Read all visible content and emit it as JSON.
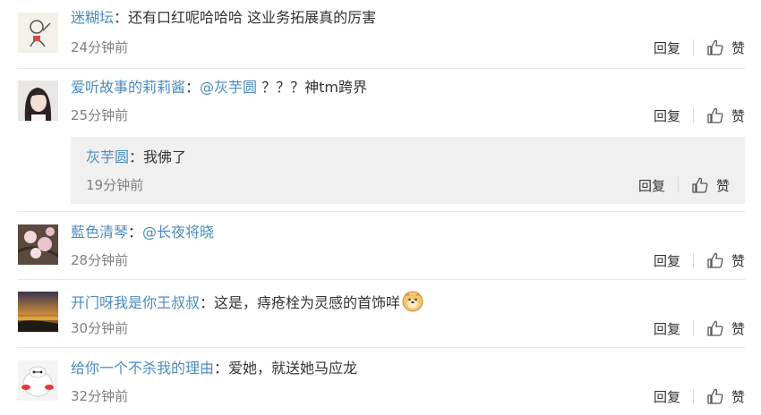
{
  "actions": {
    "reply_label": "回复",
    "like_label": "赞"
  },
  "comments": [
    {
      "user": "迷糊坛",
      "sep": "：",
      "text": "还有口红呢哈哈哈 这业务拓展真的厉害",
      "time": "24分钟前",
      "avatar": "line-drawing-avatar"
    },
    {
      "user": "爱听故事的莉莉酱",
      "sep": "：",
      "mention": "@灰芋圆",
      "text": " ？？？神tm跨界",
      "time": "25分钟前",
      "avatar": "girl-photo-avatar",
      "reply": {
        "user": "灰芋圆",
        "sep": "：",
        "text": "我佛了",
        "time": "19分钟前"
      }
    },
    {
      "user": "藍色清琴",
      "sep": "：",
      "mention": "@长夜将晓",
      "text": "",
      "time": "28分钟前",
      "avatar": "blossom-photo-avatar"
    },
    {
      "user": "开门呀我是你王叔叔",
      "sep": "：",
      "text": "这是，痔疮栓为灵感的首饰咩",
      "time": "30分钟前",
      "avatar": "sunset-photo-avatar",
      "emoji": "doge-emoji"
    },
    {
      "user": "给你一个不杀我的理由",
      "sep": "：",
      "text": "爱她，就送她马应龙",
      "time": "32分钟前",
      "avatar": "white-robot-avatar"
    }
  ]
}
